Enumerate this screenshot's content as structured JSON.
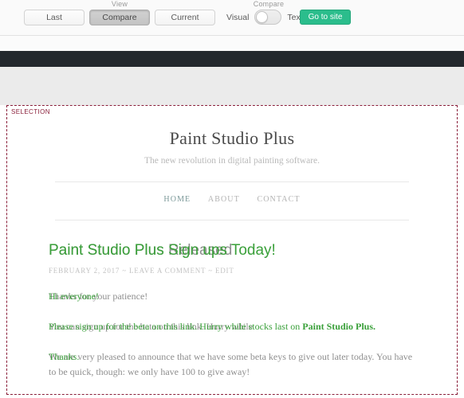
{
  "toolbar": {
    "view_caption": "View",
    "compare_caption": "Compare",
    "buttons": [
      {
        "label": "Last",
        "active": false
      },
      {
        "label": "Compare",
        "active": true
      },
      {
        "label": "Current",
        "active": false
      }
    ],
    "toggle": {
      "left_label": "Visual",
      "right_label": "Text",
      "state": "Visual"
    },
    "goto_label": "Go to site",
    "accent_green": "#2bbd8c"
  },
  "selection": {
    "tag": "SELECTION",
    "border_color": "#8a1f3a"
  },
  "site": {
    "title": "Paint Studio Plus",
    "tagline": "The new revolution in digital painting software.",
    "nav": [
      {
        "label": "HOME",
        "current": true
      },
      {
        "label": "ABOUT",
        "current": false
      },
      {
        "label": "CONTACT",
        "current": false
      }
    ]
  },
  "post": {
    "title_old": "Paint Studio Plus Released",
    "title_new": "Paint Studio Plus Sign ups Today!",
    "meta": "FEBRUARY 2, 2017 ~ LEAVE A COMMENT ~ EDIT",
    "paragraph1_old": "Thanks for your patience!",
    "paragraph1_new": "Hi everyone!",
    "paragraph2_old": "You can sign up for the beta on this link. Hurry while ",
    "paragraph2_old_bold": "",
    "paragraph2_new": "Please sign up for the beta on this link. Hurry while stocks last on ",
    "paragraph2_new_bold": "Paint Studio Plus.",
    "paragraph3_old": "We are very pleased to announce that we have some beta keys to give out later today. You have to be quick, though: we only have 100 to give away!",
    "paragraph3_new": "Thanks.",
    "old_color": "#8f8f8f",
    "new_color": "#3aa03a"
  }
}
